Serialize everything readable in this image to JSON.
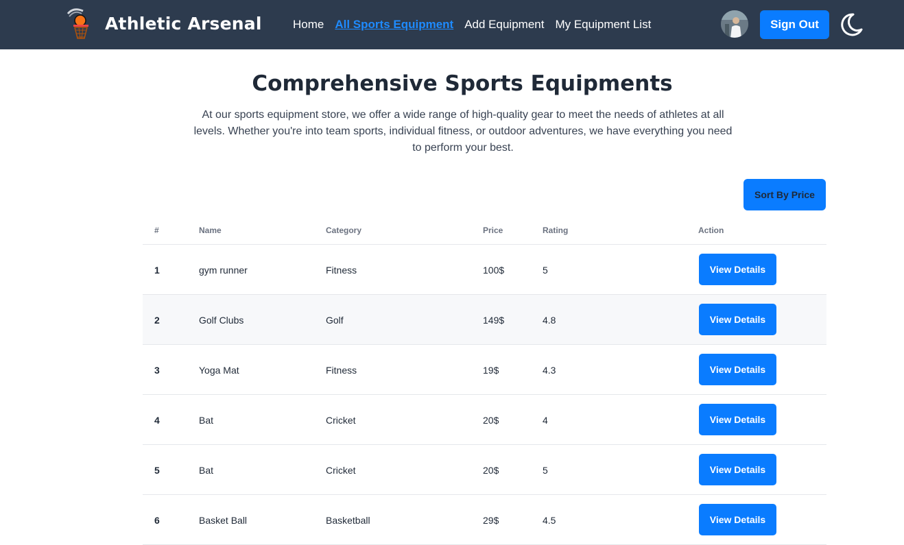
{
  "header": {
    "brand": "Athletic Arsenal",
    "nav": [
      {
        "label": "Home",
        "active": false
      },
      {
        "label": "All Sports Equipment",
        "active": true
      },
      {
        "label": "Add Equipment",
        "active": false
      },
      {
        "label": "My Equipment List",
        "active": false
      }
    ],
    "sign_out_label": "Sign Out",
    "accent_color": "#0a7cff",
    "bg_color": "#2d3b4e",
    "theme_toggle_icon": "moon-icon"
  },
  "main": {
    "title": "Comprehensive Sports Equipments",
    "description": "At our sports equipment store, we offer a wide range of high-quality gear to meet the needs of athletes at all levels. Whether you're into team sports, individual fitness, or outdoor adventures, we have everything you need to perform your best.",
    "sort_label": "Sort By Price"
  },
  "table": {
    "headers": [
      "#",
      "Name",
      "Category",
      "Price",
      "Rating",
      "Action"
    ],
    "rows": [
      {
        "num": "1",
        "name": "gym runner",
        "category": "Fitness",
        "price": "100$",
        "rating": "5",
        "action": "View Details"
      },
      {
        "num": "2",
        "name": "Golf Clubs",
        "category": "Golf",
        "price": "149$",
        "rating": "4.8",
        "action": "View Details"
      },
      {
        "num": "3",
        "name": "Yoga Mat",
        "category": "Fitness",
        "price": "19$",
        "rating": "4.3",
        "action": "View Details"
      },
      {
        "num": "4",
        "name": "Bat",
        "category": "Cricket",
        "price": "20$",
        "rating": "4",
        "action": "View Details"
      },
      {
        "num": "5",
        "name": "Bat",
        "category": "Cricket",
        "price": "20$",
        "rating": "5",
        "action": "View Details"
      },
      {
        "num": "6",
        "name": "Basket Ball",
        "category": "Basketball",
        "price": "29$",
        "rating": "4.5",
        "action": "View Details"
      }
    ]
  }
}
